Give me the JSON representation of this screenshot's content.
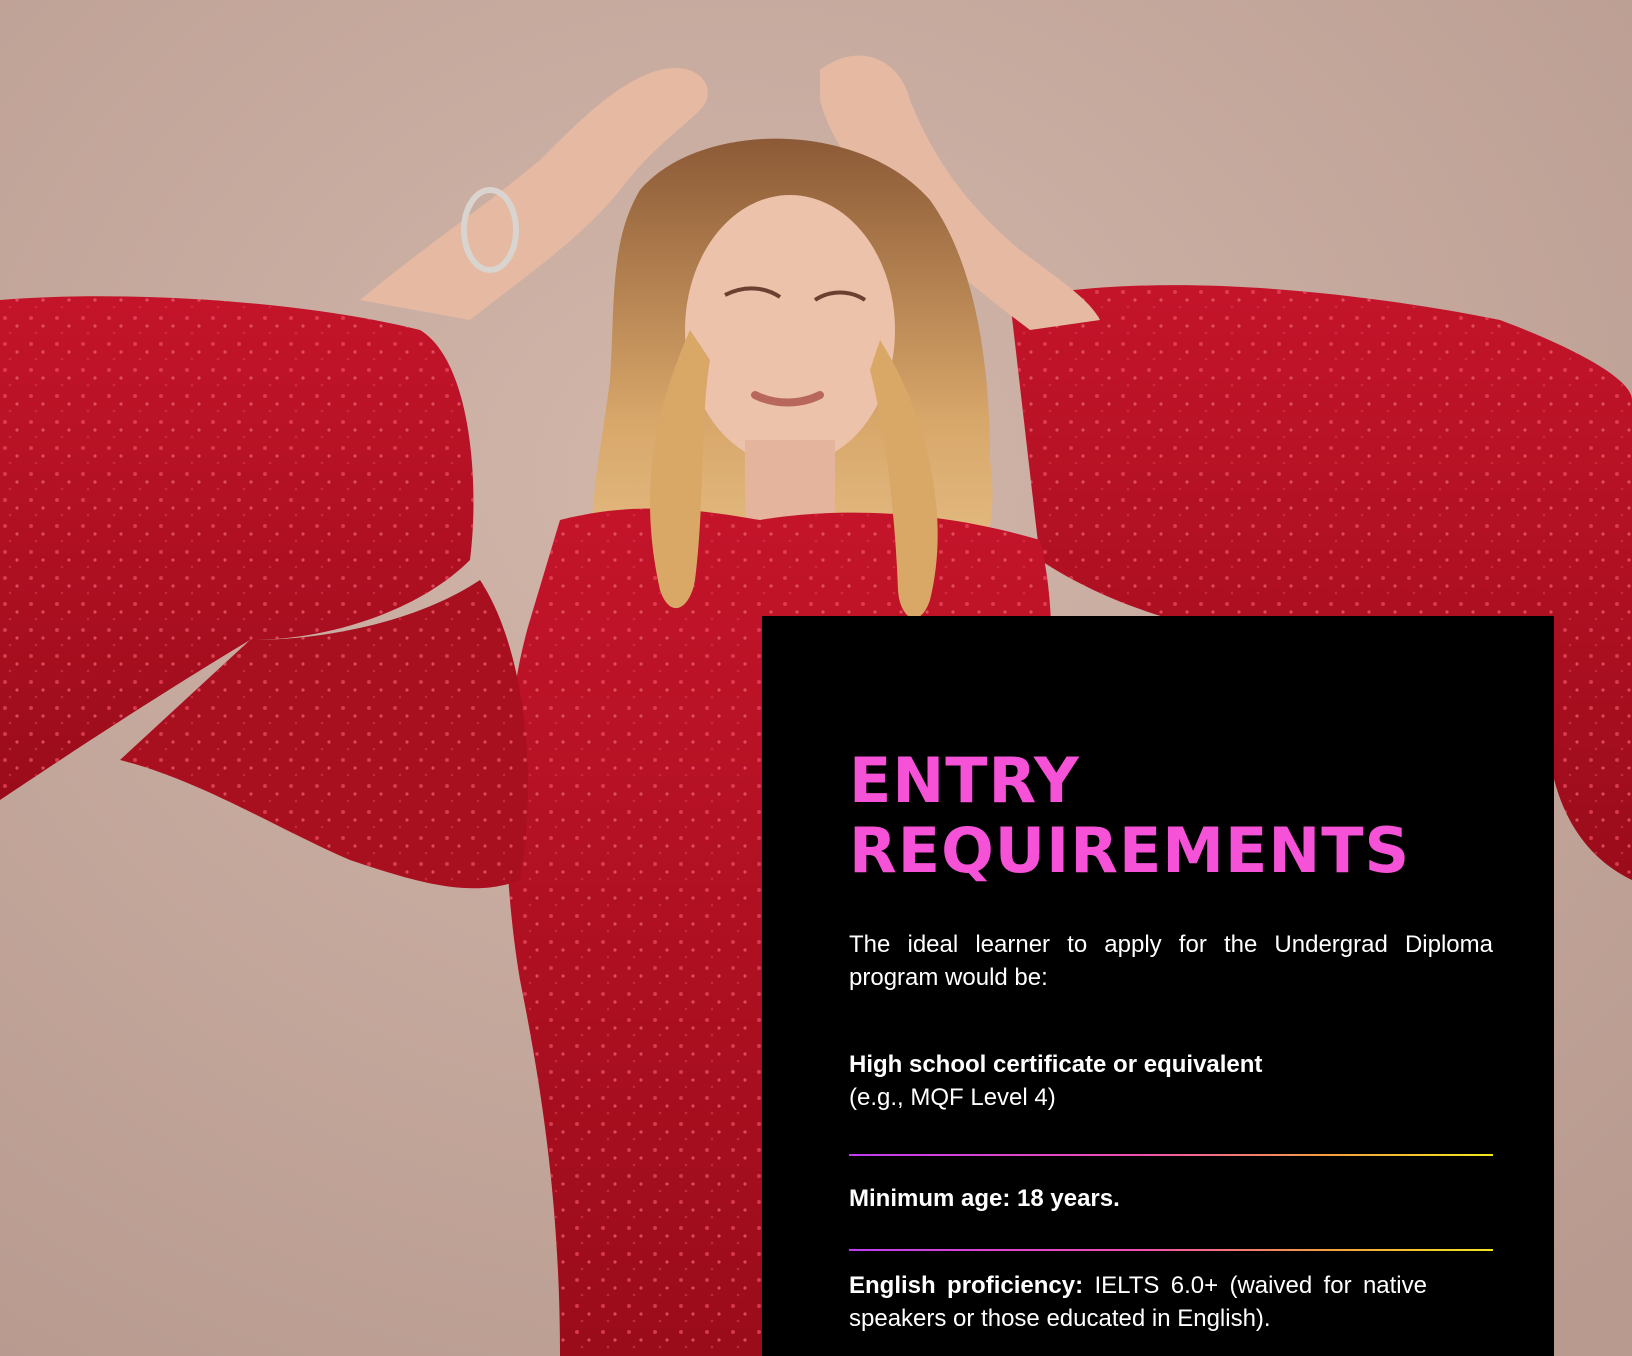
{
  "panel": {
    "title_line1": "ENTRY",
    "title_line2": "REQUIREMENTS",
    "intro": "The ideal learner to apply for the Undergrad Diploma program would be:",
    "requirements": [
      {
        "label": "High school certificate or equivalent",
        "detail": "(e.g., MQF Level 4)"
      },
      {
        "label": "Minimum age: 18 years.",
        "detail": ""
      },
      {
        "label": "English proficiency:",
        "detail": " IELTS 6.0+ (waived for native speakers or those educated in English)."
      }
    ]
  },
  "colors": {
    "background": "#c7aba0",
    "panel": "#000000",
    "title": "#f652d7",
    "dress": "#b3101f",
    "divider_start": "#c13cf1",
    "divider_end": "#f2e81f"
  }
}
